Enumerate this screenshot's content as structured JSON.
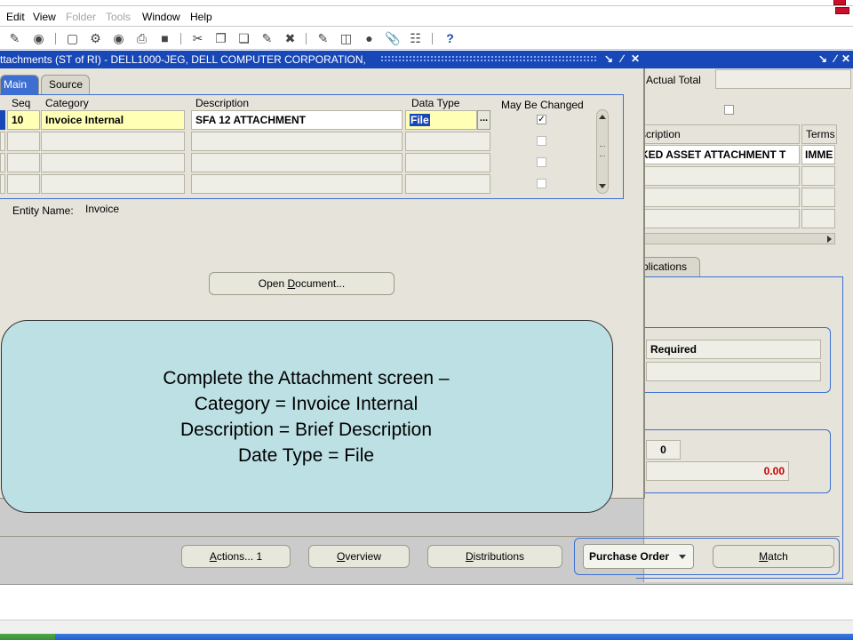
{
  "menu": {
    "items": [
      {
        "label": "Edit",
        "enabled": true
      },
      {
        "label": "View",
        "enabled": true
      },
      {
        "label": "Folder",
        "enabled": false
      },
      {
        "label": "Tools",
        "enabled": false
      },
      {
        "label": "Window",
        "enabled": true
      },
      {
        "label": "Help",
        "enabled": true
      }
    ]
  },
  "toolbar": {
    "icons": [
      "flashlight-icon",
      "navigator-icon",
      "save-icon",
      "transactions-icon",
      "zoom-icon",
      "print-icon",
      "clear-icon",
      "cut-icon",
      "copy-icon",
      "paste-icon",
      "edit-field-icon",
      "delete-record-icon",
      "translation-icon",
      "attachment-folder-icon",
      "folder-icon",
      "record-icon",
      "attachment-icon",
      "window-icon",
      "help-icon"
    ],
    "help_glyph": "?"
  },
  "attachments_window": {
    "title": "ttachments (ST of RI) - DELL1000-JEG, DELL COMPUTER CORPORATION,",
    "tabs": [
      "Main",
      "Source"
    ],
    "columns": {
      "seq": "Seq",
      "category": "Category",
      "description": "Description",
      "data_type": "Data Type",
      "may_be_changed": "May Be Changed"
    },
    "rows": [
      {
        "seq": "10",
        "category": "Invoice Internal",
        "description": "SFA 12 ATTACHMENT",
        "data_type": "File",
        "may_be_changed": true
      },
      {
        "seq": "",
        "category": "",
        "description": "",
        "data_type": "",
        "may_be_changed": false
      },
      {
        "seq": "",
        "category": "",
        "description": "",
        "data_type": "",
        "may_be_changed": false
      },
      {
        "seq": "",
        "category": "",
        "description": "",
        "data_type": "",
        "may_be_changed": false
      }
    ],
    "lov_button": "...",
    "entity_label": "Entity Name:",
    "entity_value": "Invoice",
    "open_document_prefix": "Open ",
    "open_document_underlined": "D",
    "open_document_suffix": "ocument..."
  },
  "invoice_window": {
    "actual_total_label": "Actual Total",
    "columns": {
      "description": "scription",
      "terms": "Terms"
    },
    "row1": {
      "description": "KED ASSET ATTACHMENT T",
      "terms": "IMME"
    },
    "tab_label": "plications",
    "required_label": "Required",
    "count_value": "0",
    "amount_value": "0.00",
    "match_type": "Purchase Order",
    "buttons": {
      "actions_underlined": "A",
      "actions_rest": "ctions... 1",
      "overview_underlined": "O",
      "overview_rest": "verview",
      "distributions_underlined": "D",
      "distributions_rest": "istributions",
      "match_underlined": "M",
      "match_rest": "atch"
    }
  },
  "callout": {
    "lines": [
      "Complete the Attachment screen –",
      "Category = Invoice Internal",
      "Description = Brief Description",
      "Date Type = File"
    ]
  },
  "colors": {
    "title_bar": "#1848b8",
    "active_tab": "#3d6fd2",
    "required_field": "#ffffb6",
    "callout_fill": "#bce0e3",
    "amount_text": "#cc0000"
  }
}
